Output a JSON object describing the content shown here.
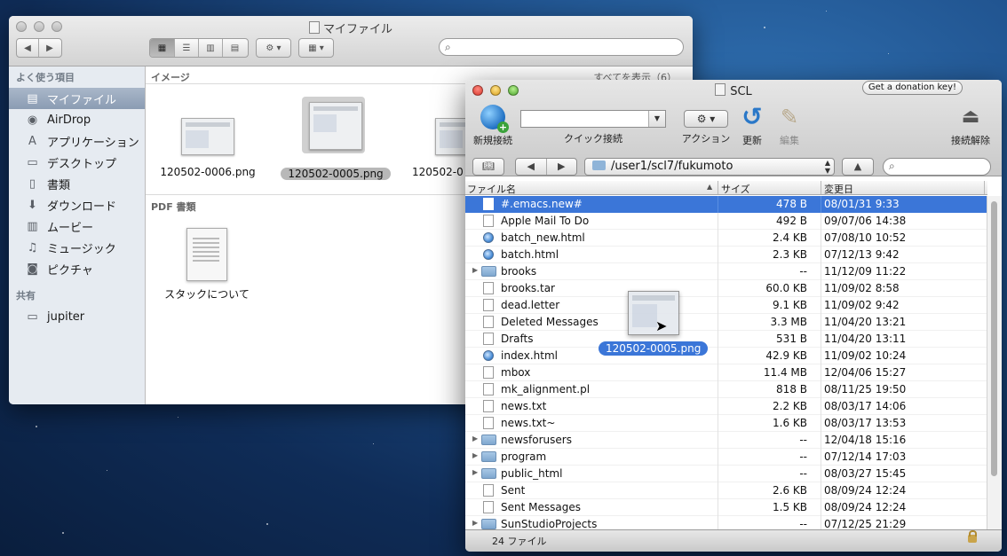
{
  "finder": {
    "title": "マイファイル",
    "sidebar": {
      "favorites_header": "よく使う項目",
      "shared_header": "共有",
      "items": [
        {
          "label": "マイファイル",
          "icon": "all-my-files-icon"
        },
        {
          "label": "AirDrop",
          "icon": "airdrop-icon"
        },
        {
          "label": "アプリケーション",
          "icon": "applications-icon"
        },
        {
          "label": "デスクトップ",
          "icon": "desktop-icon"
        },
        {
          "label": "書類",
          "icon": "documents-icon"
        },
        {
          "label": "ダウンロード",
          "icon": "downloads-icon"
        },
        {
          "label": "ムービー",
          "icon": "movies-icon"
        },
        {
          "label": "ミュージック",
          "icon": "music-icon"
        },
        {
          "label": "ピクチャ",
          "icon": "pictures-icon"
        }
      ],
      "shared": [
        {
          "label": "jupiter",
          "icon": "computer-icon"
        }
      ]
    },
    "content": {
      "images_header": "イメージ",
      "show_all": "すべてを表示（6）",
      "images": [
        "120502-0006.png",
        "120502-0005.png",
        "120502-0"
      ],
      "pdf_header": "PDF 書類",
      "pdfs": [
        "スタックについて"
      ]
    }
  },
  "scl": {
    "title": "SCL",
    "donate_label": "Get a donation key!",
    "toolbar": {
      "new_connection": "新規接続",
      "quick_connect": "クイック接続",
      "action": "アクション",
      "refresh": "更新",
      "edit": "編集",
      "disconnect": "接続解除"
    },
    "path": "/user1/scl7/fukumoto",
    "columns": {
      "name": "ファイル名",
      "size": "サイズ",
      "modified": "変更日"
    },
    "files": [
      {
        "name": "#.emacs.new#",
        "size": "478 B",
        "date": "08/01/31 9:33",
        "kind": "file"
      },
      {
        "name": "Apple Mail To Do",
        "size": "492 B",
        "date": "09/07/06 14:38",
        "kind": "file"
      },
      {
        "name": "batch_new.html",
        "size": "2.4 KB",
        "date": "07/08/10 10:52",
        "kind": "html"
      },
      {
        "name": "batch.html",
        "size": "2.3 KB",
        "date": "07/12/13 9:42",
        "kind": "html"
      },
      {
        "name": "brooks",
        "size": "--",
        "date": "11/12/09 11:22",
        "kind": "folder"
      },
      {
        "name": "brooks.tar",
        "size": "60.0 KB",
        "date": "11/09/02 8:58",
        "kind": "file"
      },
      {
        "name": "dead.letter",
        "size": "9.1 KB",
        "date": "11/09/02 9:42",
        "kind": "file"
      },
      {
        "name": "Deleted Messages",
        "size": "3.3 MB",
        "date": "11/04/20 13:21",
        "kind": "file"
      },
      {
        "name": "Drafts",
        "size": "531 B",
        "date": "11/04/20 13:11",
        "kind": "file"
      },
      {
        "name": "index.html",
        "size": "42.9 KB",
        "date": "11/09/02 10:24",
        "kind": "html"
      },
      {
        "name": "mbox",
        "size": "11.4 MB",
        "date": "12/04/06 15:27",
        "kind": "file"
      },
      {
        "name": "mk_alignment.pl",
        "size": "818 B",
        "date": "08/11/25 19:50",
        "kind": "file"
      },
      {
        "name": "news.txt",
        "size": "2.2 KB",
        "date": "08/03/17 14:06",
        "kind": "file"
      },
      {
        "name": "news.txt~",
        "size": "1.6 KB",
        "date": "08/03/17 13:53",
        "kind": "file"
      },
      {
        "name": "newsforusers",
        "size": "--",
        "date": "12/04/18 15:16",
        "kind": "folder"
      },
      {
        "name": "program",
        "size": "--",
        "date": "07/12/14 17:03",
        "kind": "folder"
      },
      {
        "name": "public_html",
        "size": "--",
        "date": "08/03/27 15:45",
        "kind": "folder"
      },
      {
        "name": "Sent",
        "size": "2.6 KB",
        "date": "08/09/24 12:24",
        "kind": "file"
      },
      {
        "name": "Sent Messages",
        "size": "1.5 KB",
        "date": "08/09/24 12:24",
        "kind": "file"
      },
      {
        "name": "SunStudioProjects",
        "size": "--",
        "date": "07/12/25 21:29",
        "kind": "folder"
      }
    ],
    "status_count": "24 ファイル"
  },
  "drag_item": {
    "label": "120502-0005.png"
  }
}
